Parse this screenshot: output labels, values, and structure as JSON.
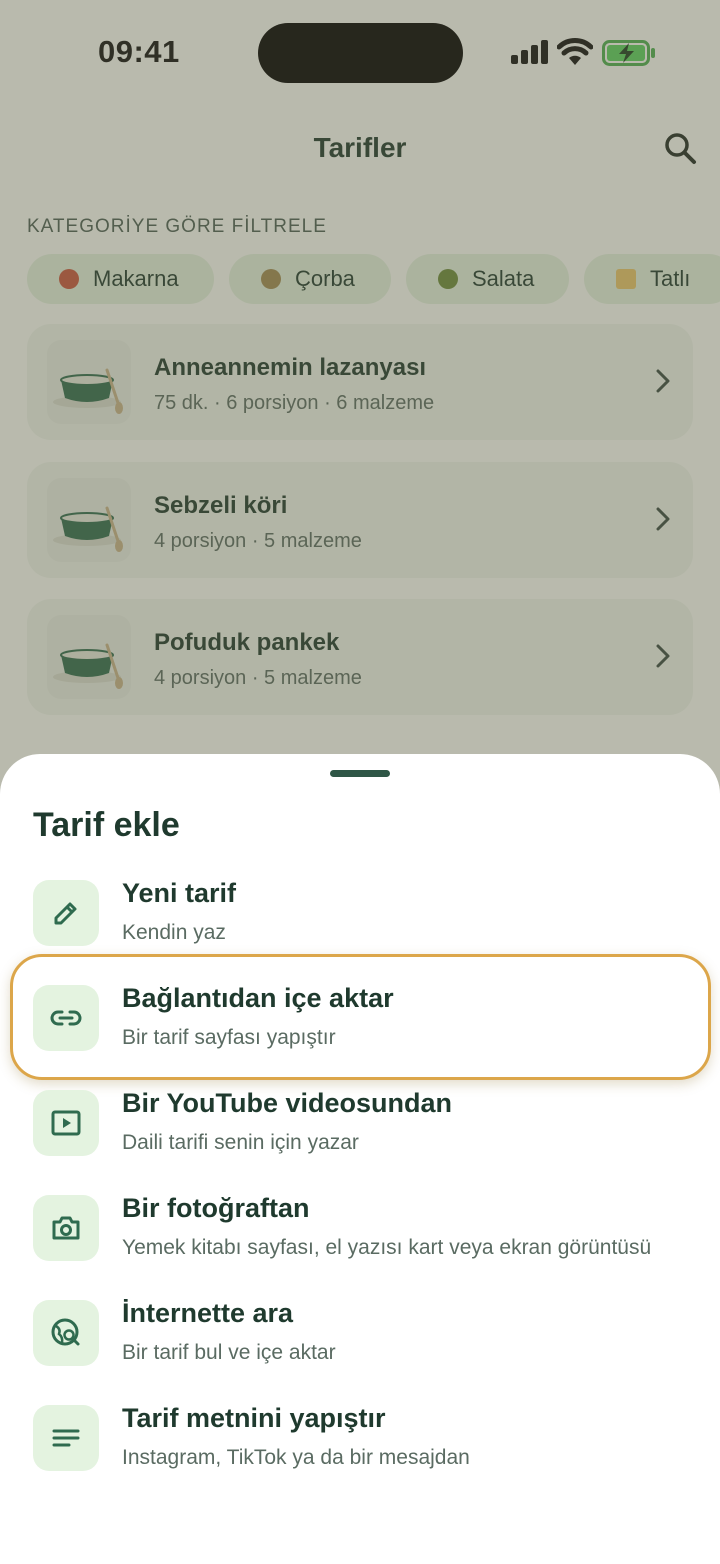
{
  "status_bar": {
    "time": "09:41"
  },
  "header": {
    "title": "Tarifler"
  },
  "filters": {
    "label": "KATEGORİYE GÖRE FİLTRELE",
    "chips": [
      {
        "label": "Makarna",
        "color": "#c8553d"
      },
      {
        "label": "Çorba",
        "color": "#a08a52"
      },
      {
        "label": "Salata",
        "color": "#6b8a3a"
      },
      {
        "label": "Tatlı",
        "color": "#e9c46a"
      }
    ]
  },
  "recipes": [
    {
      "title": "Anneannemin lazanyası",
      "meta": "75 dk. · 6 porsiyon · 6 malzeme"
    },
    {
      "title": "Sebzeli köri",
      "meta": "4 porsiyon · 5 malzeme"
    },
    {
      "title": "Pofuduk pankek",
      "meta": "4 porsiyon · 5 malzeme"
    }
  ],
  "sheet": {
    "title": "Tarif ekle",
    "options": [
      {
        "title": "Yeni tarif",
        "subtitle": "Kendin yaz",
        "icon": "pencil-icon"
      },
      {
        "title": "Bağlantıdan içe aktar",
        "subtitle": "Bir tarif sayfası yapıştır",
        "icon": "link-icon"
      },
      {
        "title": "Bir YouTube videosundan",
        "subtitle": "Daili tarifi senin için yazar",
        "icon": "video-play-icon"
      },
      {
        "title": "Bir fotoğraftan",
        "subtitle": "Yemek kitabı sayfası, el yazısı kart veya ekran görüntüsü",
        "icon": "camera-icon"
      },
      {
        "title": "İnternette ara",
        "subtitle": "Bir tarif bul ve içe aktar",
        "icon": "globe-search-icon"
      },
      {
        "title": "Tarif metnini yapıştır",
        "subtitle": "Instagram, TikTok ya da bir mesajdan",
        "icon": "text-lines-icon"
      }
    ]
  },
  "colors": {
    "accent": "#2f6b4f",
    "highlight": "#dca64a",
    "icon_bg": "#e4f3e0"
  }
}
